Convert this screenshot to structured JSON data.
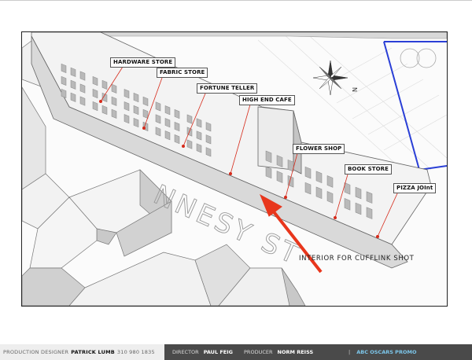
{
  "labels": {
    "hardware": "HARDWARE STORE",
    "fabric": "FABRIC STORE",
    "fortune": "FORTUNE TELLER",
    "cafe": "HIGH END CAFE",
    "flower": "FLOWER SHOP",
    "book": "BOOK STORE",
    "pizza": "PIZZA JOInt"
  },
  "street_text": "NNESY ST",
  "compass_letter": "N",
  "note": "INTERIOR FOR CUFFLINK SHOT",
  "footer": {
    "designer_label": "PRODUCTION DESIGNER",
    "designer_name": "PATRICK LUMB",
    "designer_phone": "310 980 1835",
    "director_label": "DIRECTOR",
    "director_name": "PAUL FEIG",
    "producer_label": "PRODUCER",
    "producer_name": "NORM REISS",
    "separator": "|",
    "project": "ABC OSCARS PROMO"
  },
  "colors": {
    "arrow": "#e8361c",
    "lot_line": "#2a3fd6",
    "building_top": "#f2f2f2",
    "building_side": "#cfcfcf",
    "label_leader": "#d62a1a"
  }
}
